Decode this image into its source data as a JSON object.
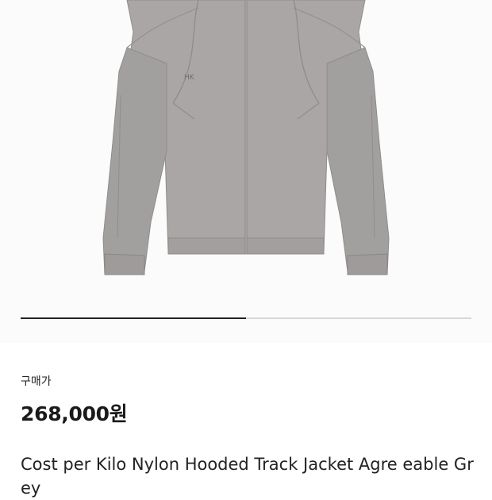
{
  "product": {
    "image_subject": "grey-hooded-track-jacket",
    "brand_mark": "ᴴᴋ",
    "jacket_color": "#a7a4a3",
    "carousel_progress": 0.5
  },
  "purchase": {
    "price_label": "구매가",
    "price": "268,000원"
  },
  "title": "Cost per Kilo Nylon Hooded Track Jacket Agre eable Grey"
}
